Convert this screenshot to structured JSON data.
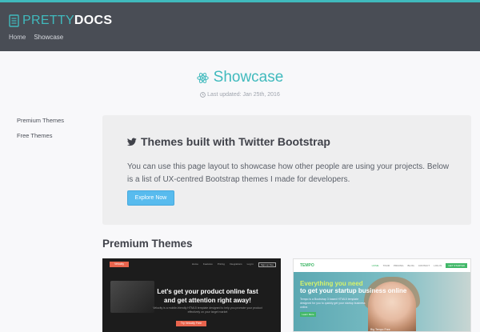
{
  "header": {
    "logo_light": "PRETTY",
    "logo_bold": "DOCS",
    "breadcrumb": [
      {
        "label": "Home"
      },
      {
        "label": "Showcase"
      }
    ],
    "colors": {
      "bar": "#494d55",
      "accent": "#40babd"
    }
  },
  "doc": {
    "title": "Showcase",
    "updated": "Last updated: Jan 25th, 2016",
    "title_icon": "react-icon",
    "updated_icon": "clock-icon"
  },
  "sidebar": {
    "items": [
      {
        "label": "Premium Themes"
      },
      {
        "label": "Free Themes"
      }
    ]
  },
  "callout": {
    "icon": "twitter-icon",
    "title": "Themes built with Twitter Bootstrap",
    "text": "You can use this page layout to showcase how other people are using your projects. Below is a list of UX-centred Bootstrap themes I made for developers.",
    "button": "Explore Now",
    "button_color": "#58bbee"
  },
  "section": {
    "title": "Premium Themes"
  },
  "cards": {
    "velocity": {
      "badge": "Velocity",
      "nav": [
        "Home",
        "Features",
        "Pricing",
        "Integrations",
        "Log in",
        "Sign up free"
      ],
      "headline_1": "Let's get your product online fast",
      "headline_2": "and get attention right away!",
      "sub": "Velocity is a mobile-friendly HTML5 template designed to help you promote your product effectively on your target market",
      "button": "Try Velocity Free"
    },
    "tempo": {
      "logo": "TEMPO",
      "nav": [
        "HOME",
        "TOUR",
        "PRICING",
        "BLOG",
        "CONTACT",
        "LOG IN",
        "GET STARTED"
      ],
      "headline_1": "Everything you need",
      "headline_2": "to get your startup business online",
      "sub": "Tempo is a Bootstrap 3 based HTML5 template designed for you to quickly get your startup business online.",
      "button": "Learn More",
      "caption": "Big Tempo Free"
    }
  }
}
